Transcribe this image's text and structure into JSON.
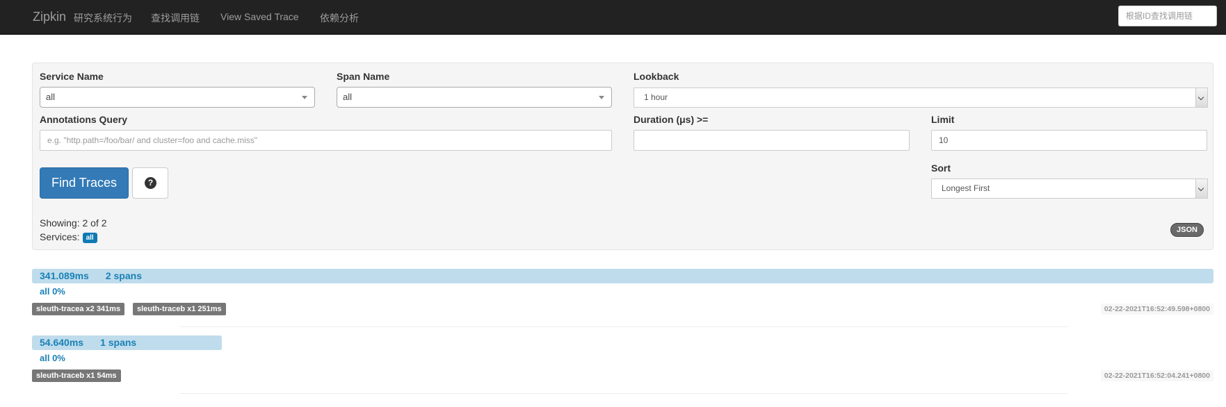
{
  "navbar": {
    "brand": "Zipkin",
    "brand_subtitle": "研究系统行为",
    "links": [
      "查找调用链",
      "View Saved Trace",
      "依赖分析"
    ],
    "search_placeholder": "根据ID查找调用链"
  },
  "search": {
    "service_name_label": "Service Name",
    "service_name_value": "all",
    "span_name_label": "Span Name",
    "span_name_value": "all",
    "lookback_label": "Lookback",
    "lookback_value": "1 hour",
    "annotations_label": "Annotations Query",
    "annotations_placeholder": "e.g. \"http.path=/foo/bar/ and cluster=foo and cache.miss\"",
    "duration_label": "Duration (μs) >=",
    "duration_value": "",
    "limit_label": "Limit",
    "limit_value": "10",
    "sort_label": "Sort",
    "sort_value": "Longest First",
    "find_button": "Find Traces",
    "help_icon_glyph": "?",
    "showing_text": "Showing: 2 of 2",
    "services_label": "Services:",
    "services_badge": "all",
    "json_button": "JSON"
  },
  "traces": [
    {
      "duration": "341.089ms",
      "spans": "2 spans",
      "width_fraction": 1.0,
      "service_pct": "all 0%",
      "tags": [
        "sleuth-tracea x2 341ms",
        "sleuth-traceb x1 251ms"
      ],
      "timestamp": "02-22-2021T16:52:49.598+0800"
    },
    {
      "duration": "54.640ms",
      "spans": "1 spans",
      "width_fraction": 0.16,
      "service_pct": "all 0%",
      "tags": [
        "sleuth-traceb x1 54ms"
      ],
      "timestamp": "02-22-2021T16:52:04.241+0800"
    }
  ],
  "colors": {
    "navbar_bg": "#222222",
    "primary": "#337ab7",
    "trace_bar": "#bfdcec",
    "trace_text": "#1a81b6",
    "tag_bg": "#777777"
  }
}
